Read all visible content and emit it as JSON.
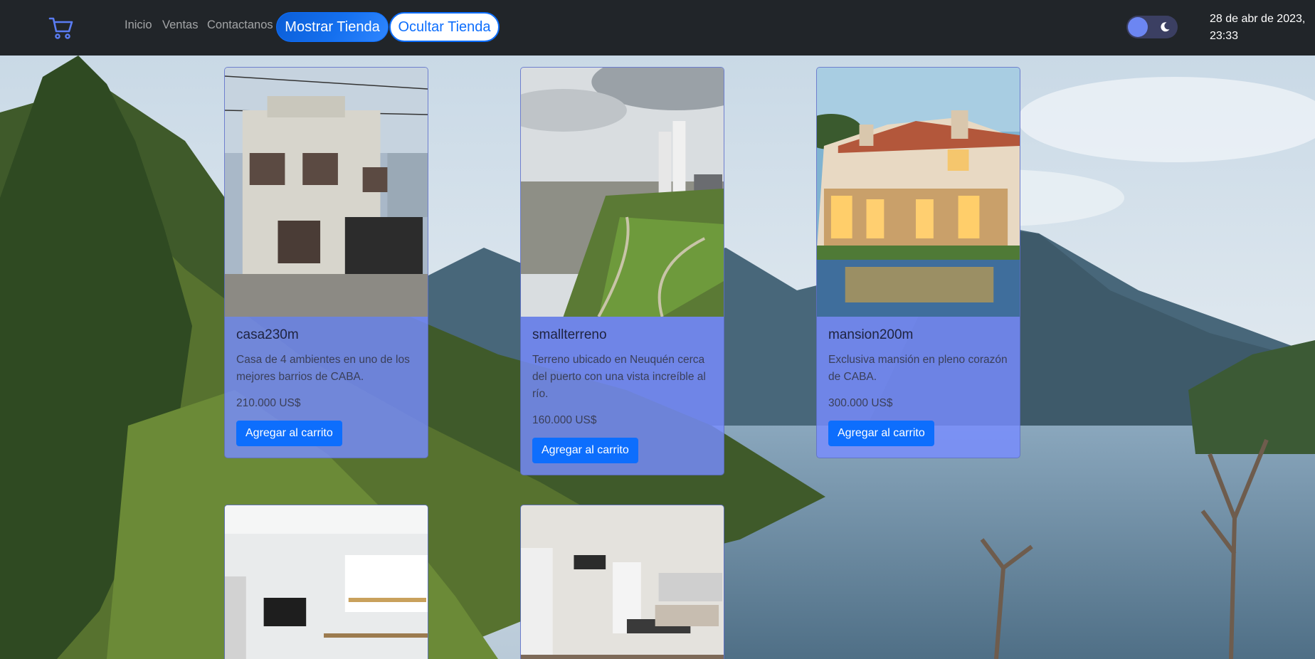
{
  "navbar": {
    "cart_icon": "shopping-cart-icon",
    "links": [
      "Inicio",
      "Ventas",
      "Contactanos"
    ],
    "show_store_label": "Mostrar Tienda",
    "hide_store_label": "Ocultar Tienda",
    "theme_icon": "moon-icon",
    "datetime_line1": "28 de abr de 2023,",
    "datetime_line2": "23:33"
  },
  "cards": [
    {
      "title": "casa230m",
      "description": "Casa de 4 ambientes en uno de los mejores barrios de CABA.",
      "price": "210.000 US$",
      "button_label": "Agregar al carrito"
    },
    {
      "title": "smallterreno",
      "description": "Terreno ubicado en Neuquén cerca del puerto con una vista increíble al río.",
      "price": "160.000 US$",
      "button_label": "Agregar al carrito"
    },
    {
      "title": "mansion200m",
      "description": "Exclusiva mansión en pleno corazón de CABA.",
      "price": "300.000 US$",
      "button_label": "Agregar al carrito"
    }
  ],
  "colors": {
    "navbar_bg": "#212529",
    "primary": "#0d6efd",
    "card_bg": "#788cff"
  }
}
